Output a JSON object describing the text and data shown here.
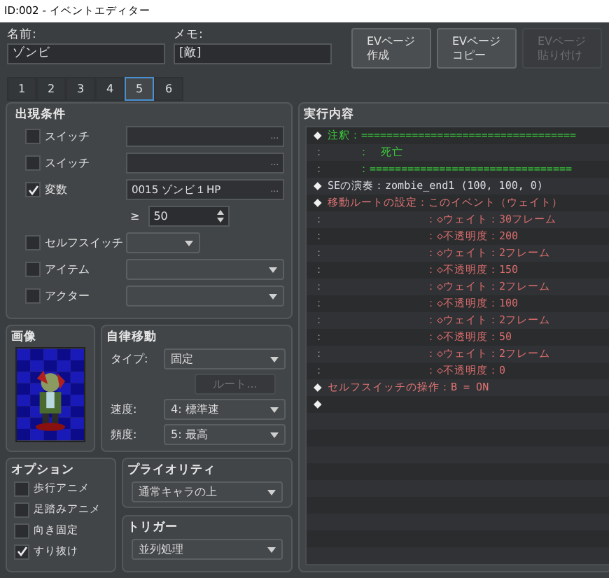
{
  "window": {
    "title": "ID:002 - イベントエディター"
  },
  "name": {
    "label": "名前:",
    "value": "ゾンビ"
  },
  "memo": {
    "label": "メモ:",
    "value": "[敵]"
  },
  "page_buttons": [
    {
      "lines": [
        "EVページ",
        "作成"
      ],
      "disabled": false
    },
    {
      "lines": [
        "EVページ",
        "コピー"
      ],
      "disabled": false
    },
    {
      "lines": [
        "EVページ",
        "貼り付け"
      ],
      "disabled": true
    }
  ],
  "tabs": [
    {
      "label": "1",
      "selected": false
    },
    {
      "label": "2",
      "selected": false
    },
    {
      "label": "3",
      "selected": false
    },
    {
      "label": "4",
      "selected": false
    },
    {
      "label": "5",
      "selected": true
    },
    {
      "label": "6",
      "selected": false
    }
  ],
  "conditions": {
    "title": "出現条件",
    "items": [
      {
        "kind": "picker",
        "label": "スイッチ",
        "checked": false,
        "value": "",
        "button": "..."
      },
      {
        "kind": "picker",
        "label": "スイッチ",
        "checked": false,
        "value": "",
        "button": "..."
      },
      {
        "kind": "picker",
        "label": "変数",
        "checked": true,
        "value": "0015 ゾンビ１HP",
        "button": "..."
      },
      {
        "kind": "spin",
        "operator": "≥",
        "value": "50"
      },
      {
        "kind": "small_select",
        "label": "セルフスイッチ",
        "checked": false,
        "value": ""
      },
      {
        "kind": "select",
        "label": "アイテム",
        "checked": false,
        "value": ""
      },
      {
        "kind": "select",
        "label": "アクター",
        "checked": false,
        "value": ""
      }
    ]
  },
  "image": {
    "title": "画像"
  },
  "movement": {
    "title": "自律移動",
    "type_label": "タイプ:",
    "type": "固定",
    "route_button": {
      "label": "ルート...",
      "disabled": true
    },
    "speed_label": "速度:",
    "speed": "4: 標準速",
    "frequency_label": "頻度:",
    "frequency": "5: 最高"
  },
  "options": {
    "title": "オプション",
    "items": [
      {
        "label": "歩行アニメ",
        "checked": false
      },
      {
        "label": "足踏みアニメ",
        "checked": false
      },
      {
        "label": "向き固定",
        "checked": false
      },
      {
        "label": "すり抜け",
        "checked": true
      }
    ]
  },
  "priority": {
    "title": "プライオリティ",
    "value": "通常キャラの上"
  },
  "trigger": {
    "title": "トリガー",
    "value": "並列処理"
  },
  "commands": {
    "title": "実行内容",
    "rows": [
      {
        "kind": "comment",
        "gutter": "◆",
        "text": "注釈：=================================="
      },
      {
        "kind": "comment_cont",
        "gutter": "：",
        "text": "：　死亡"
      },
      {
        "kind": "comment_cont",
        "gutter": "：",
        "text": "：================================"
      },
      {
        "kind": "se",
        "gutter": "◆",
        "text": "SEの演奏：zombie_end1 (100, 100, 0)"
      },
      {
        "kind": "move",
        "gutter": "◆",
        "text": "移動ルートの設定：このイベント（ウェイト）"
      },
      {
        "kind": "move_cont",
        "gutter": "：",
        "text": "：◇ウェイト：30フレーム"
      },
      {
        "kind": "move_cont",
        "gutter": "：",
        "text": "：◇不透明度：200"
      },
      {
        "kind": "move_cont",
        "gutter": "：",
        "text": "：◇ウェイト：2フレーム"
      },
      {
        "kind": "move_cont",
        "gutter": "：",
        "text": "：◇不透明度：150"
      },
      {
        "kind": "move_cont",
        "gutter": "：",
        "text": "：◇ウェイト：2フレーム"
      },
      {
        "kind": "move_cont",
        "gutter": "：",
        "text": "：◇不透明度：100"
      },
      {
        "kind": "move_cont",
        "gutter": "：",
        "text": "：◇ウェイト：2フレーム"
      },
      {
        "kind": "move_cont",
        "gutter": "：",
        "text": "：◇不透明度：50"
      },
      {
        "kind": "move_cont",
        "gutter": "：",
        "text": "：◇ウェイト：2フレーム"
      },
      {
        "kind": "move_cont",
        "gutter": "：",
        "text": "：◇不透明度：0"
      },
      {
        "kind": "switch",
        "gutter": "◆",
        "text": "セルフスイッチの操作：B = ON"
      },
      {
        "kind": "blank",
        "gutter": "◆"
      }
    ]
  }
}
